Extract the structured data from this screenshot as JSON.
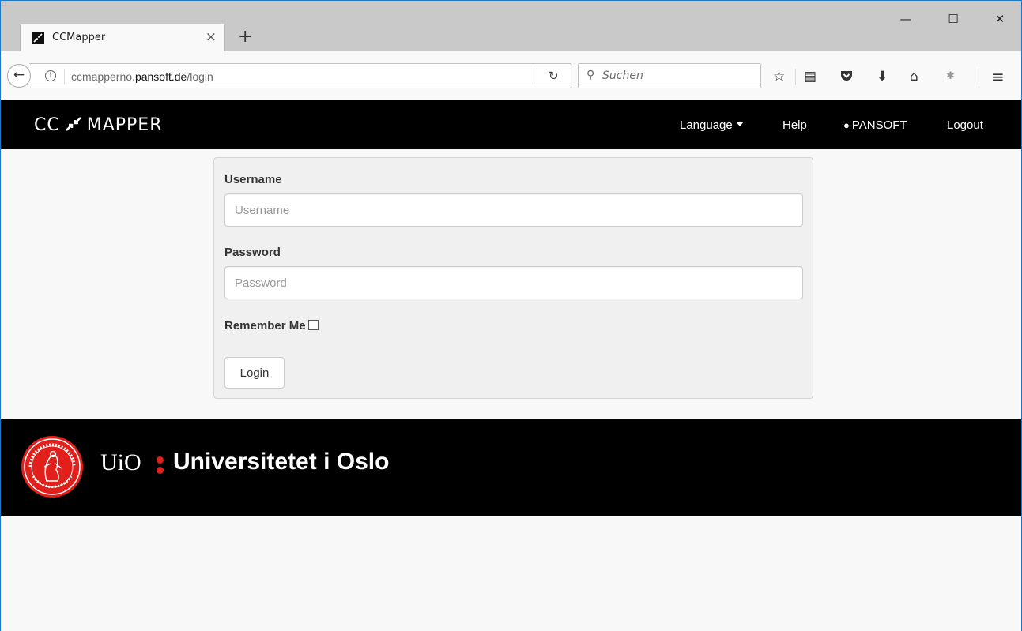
{
  "browser": {
    "tab_title": "CCMapper",
    "tab_close": "×",
    "new_tab": "+",
    "url_plain_start": "ccmapperno.",
    "url_domain": "pansoft.de",
    "url_path": "/login",
    "search_placeholder": "Suchen",
    "window_minimize": "—",
    "window_maximize": "☐",
    "window_close": "✕"
  },
  "navbar": {
    "brand_left": "CC",
    "brand_right": "MAPPER",
    "language": "Language",
    "help": "Help",
    "user": "PANSOFT",
    "logout": "Logout"
  },
  "form": {
    "username_label": "Username",
    "username_placeholder": "Username",
    "password_label": "Password",
    "password_placeholder": "Password",
    "remember_label": "Remember Me",
    "login_button": "Login"
  },
  "footer": {
    "uio": "UiO",
    "university_name": "Universitetet i Oslo",
    "accent_color": "#e1201c"
  },
  "icons": [
    "back-arrow-icon",
    "info-icon",
    "reload-icon",
    "search-icon",
    "star-icon",
    "reading-list-icon",
    "pocket-icon",
    "download-icon",
    "home-icon",
    "extension-icon",
    "menu-icon",
    "user-icon",
    "caret-down-icon",
    "uio-seal-icon"
  ]
}
